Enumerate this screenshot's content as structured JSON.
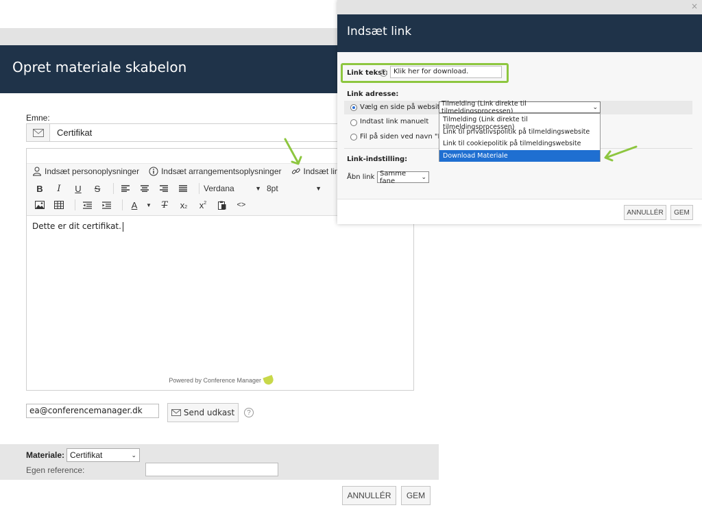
{
  "main_modal": {
    "title": "Opret materiale skabelon",
    "subject_label": "Emne:",
    "subject_value": "Certifikat",
    "toolbar": {
      "insert_person_info": "Indsæt personoplysninger",
      "insert_event_info": "Indsæt arrangementsoplysninger",
      "insert_link": "Indsæt link",
      "bold": "B",
      "italic": "I",
      "underline": "U",
      "strike": "S",
      "font_family": "Verdana",
      "font_size": "8pt",
      "font_color": "A",
      "clear_format": "T",
      "subscript": "x",
      "superscript": "x",
      "source": "<>"
    },
    "content_text": "Dette er dit certifikat.",
    "powered_by": "Powered by Conference Manager",
    "email_value": "ea@conferencemanager.dk",
    "send_draft_label": "Send udkast",
    "help_glyph": "?",
    "material_label": "Materiale:",
    "material_value": "Certifikat",
    "own_reference_label": "Egen reference:",
    "own_reference_value": "",
    "cancel_label": "ANNULLÉR",
    "save_label": "GEM"
  },
  "link_modal": {
    "title": "Indsæt link",
    "close_glyph": "×",
    "link_text_label": "Link tekst:",
    "link_text_value": "Klik her for download.",
    "link_address_label": "Link adresse:",
    "radio_options": [
      "Vælg en side på websitet",
      "Indtast link manuelt",
      "Fil på siden ved navn \"Dow"
    ],
    "selected_page": "Tilmelding (Link direkte til tilmeldingsprocessen)",
    "dropdown_options": [
      "Tilmelding (Link direkte til tilmeldingsprocessen)",
      "Link til privatlivspolitik på tilmeldingswebsite",
      "Link til cookiepolitik på tilmeldingswebsite",
      "Download Materiale"
    ],
    "highlighted_option": "Download Materiale",
    "link_setting_label": "Link-indstilling:",
    "open_link_in_label": "Åbn link i",
    "open_link_in_value": "Samme fane",
    "cancel_label": "ANNULLÉR",
    "save_label": "GEM"
  },
  "colors": {
    "header_bg": "#1f3349",
    "highlight_green": "#8dc63f",
    "selected_option": "#1f6fd1"
  }
}
